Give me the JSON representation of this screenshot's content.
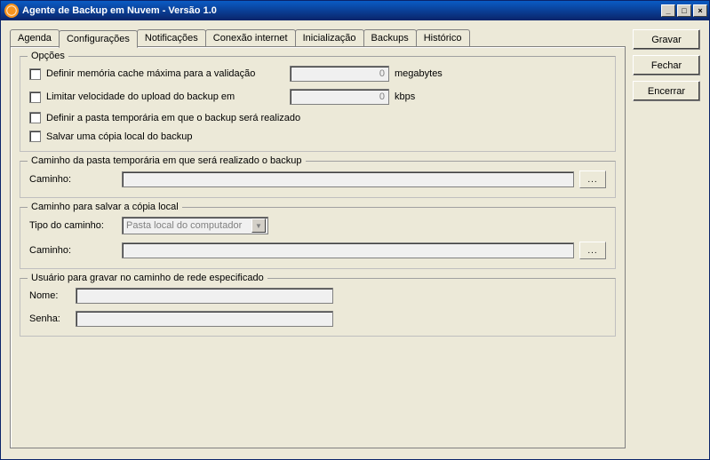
{
  "window": {
    "title": "Agente de Backup em Nuvem - Versão 1.0"
  },
  "tabs": {
    "agenda": "Agenda",
    "config": "Configurações",
    "notif": "Notificações",
    "conexao": "Conexão internet",
    "init": "Inicialização",
    "backups": "Backups",
    "hist": "Histórico"
  },
  "sidebar": {
    "gravar": "Gravar",
    "fechar": "Fechar",
    "encerrar": "Encerrar"
  },
  "opcoes": {
    "legend": "Opções",
    "cache_label": "Definir memória cache máxima para a validação",
    "cache_value": "0",
    "cache_unit": "megabytes",
    "limit_label": "Limitar velocidade do upload do backup em",
    "limit_value": "0",
    "limit_unit": "kbps",
    "temp_label": "Definir a pasta temporária em que o backup será realizado",
    "local_label": "Salvar uma cópia local do backup"
  },
  "temp": {
    "legend": "Caminho da pasta temporária em que será realizado o backup",
    "path_label": "Caminho:",
    "path_value": "",
    "browse": "..."
  },
  "local": {
    "legend": "Caminho para salvar a cópia local",
    "type_label": "Tipo do caminho:",
    "type_value": "Pasta local do computador",
    "path_label": "Caminho:",
    "path_value": "",
    "browse": "..."
  },
  "user": {
    "legend": "Usuário para gravar no caminho de rede especificado",
    "name_label": "Nome:",
    "name_value": "",
    "pass_label": "Senha:",
    "pass_value": ""
  }
}
